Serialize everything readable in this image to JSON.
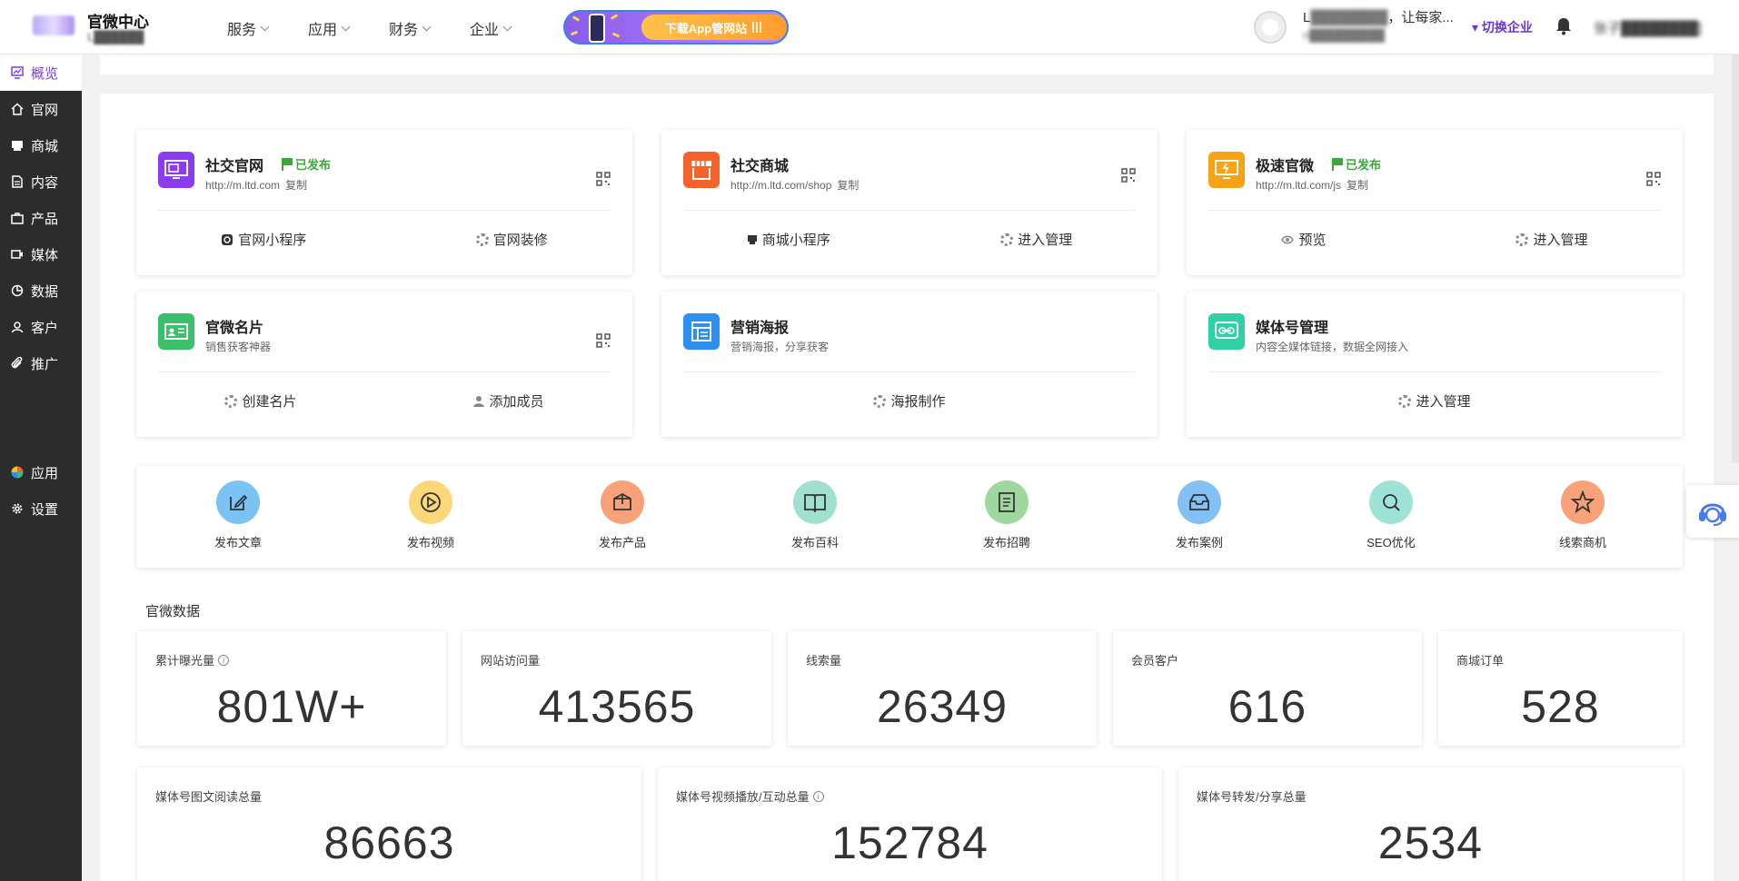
{
  "brand": {
    "title": "官微中心",
    "subtitle": "L██████"
  },
  "nav": [
    "服务",
    "应用",
    "财务",
    "企业"
  ],
  "banner": {
    "button": "下载App管网站"
  },
  "enterprise": {
    "name_prefix": "L",
    "name_blur": "████████",
    "name_suffix": "，让每家...",
    "sub": "n█████████",
    "switch": "切换企业"
  },
  "user": {
    "name": "张子████████]"
  },
  "sidebar": {
    "items": [
      "概览",
      "官网",
      "商城",
      "内容",
      "产品",
      "媒体",
      "数据",
      "客户",
      "推广"
    ],
    "bottom": [
      "应用",
      "设置"
    ]
  },
  "cards": [
    {
      "title": "社交官网",
      "status": "已发布",
      "url": "http://m.ltd.com",
      "copy": "复制",
      "actions": [
        "官网小程序",
        "官网装修"
      ],
      "color": "#8b3cf0"
    },
    {
      "title": "社交商城",
      "url": "http://m.ltd.com/shop",
      "copy": "复制",
      "actions": [
        "商城小程序",
        "进入管理"
      ],
      "color": "#f5632a"
    },
    {
      "title": "极速官微",
      "status": "已发布",
      "url": "http://m.ltd.com/js",
      "copy": "复制",
      "actions": [
        "预览",
        "进入管理"
      ],
      "color": "#f7a313"
    },
    {
      "title": "官微名片",
      "desc": "销售获客神器",
      "actions": [
        "创建名片",
        "添加成员"
      ],
      "color": "#3cbf6b"
    },
    {
      "title": "营销海报",
      "desc": "营销海报，分享获客",
      "actions": [
        "海报制作"
      ],
      "color": "#2e8ff0"
    },
    {
      "title": "媒体号管理",
      "desc": "内容全媒体链接，数据全网接入",
      "actions": [
        "进入管理"
      ],
      "color": "#2fd1a6"
    }
  ],
  "quick_actions": [
    {
      "label": "发布文章",
      "icon": "edit-icon",
      "color": "#7cc3f5"
    },
    {
      "label": "发布视频",
      "icon": "play-icon",
      "color": "#fbd77a"
    },
    {
      "label": "发布产品",
      "icon": "box-icon",
      "color": "#f9a27a"
    },
    {
      "label": "发布百科",
      "icon": "book-icon",
      "color": "#9fe0d0"
    },
    {
      "label": "发布招聘",
      "icon": "document-icon",
      "color": "#9ed89e"
    },
    {
      "label": "发布案例",
      "icon": "inbox-icon",
      "color": "#83c0f5"
    },
    {
      "label": "SEO优化",
      "icon": "search-icon",
      "color": "#9fe3d6"
    },
    {
      "label": "线索商机",
      "icon": "star-icon",
      "color": "#f9a27a"
    }
  ],
  "section_title": "官微数据",
  "stats_row1": [
    {
      "label": "累计曝光量",
      "value": "801W+",
      "info": true
    },
    {
      "label": "网站访问量",
      "value": "413565"
    },
    {
      "label": "线索量",
      "value": "26349"
    },
    {
      "label": "会员客户",
      "value": "616"
    },
    {
      "label": "商城订单",
      "value": "528"
    }
  ],
  "stats_row2": [
    {
      "label": "媒体号图文阅读总量",
      "value": "86663"
    },
    {
      "label": "媒体号视频播放/互动总量",
      "value": "152784",
      "info": true
    },
    {
      "label": "媒体号转发/分享总量",
      "value": "2534"
    }
  ]
}
